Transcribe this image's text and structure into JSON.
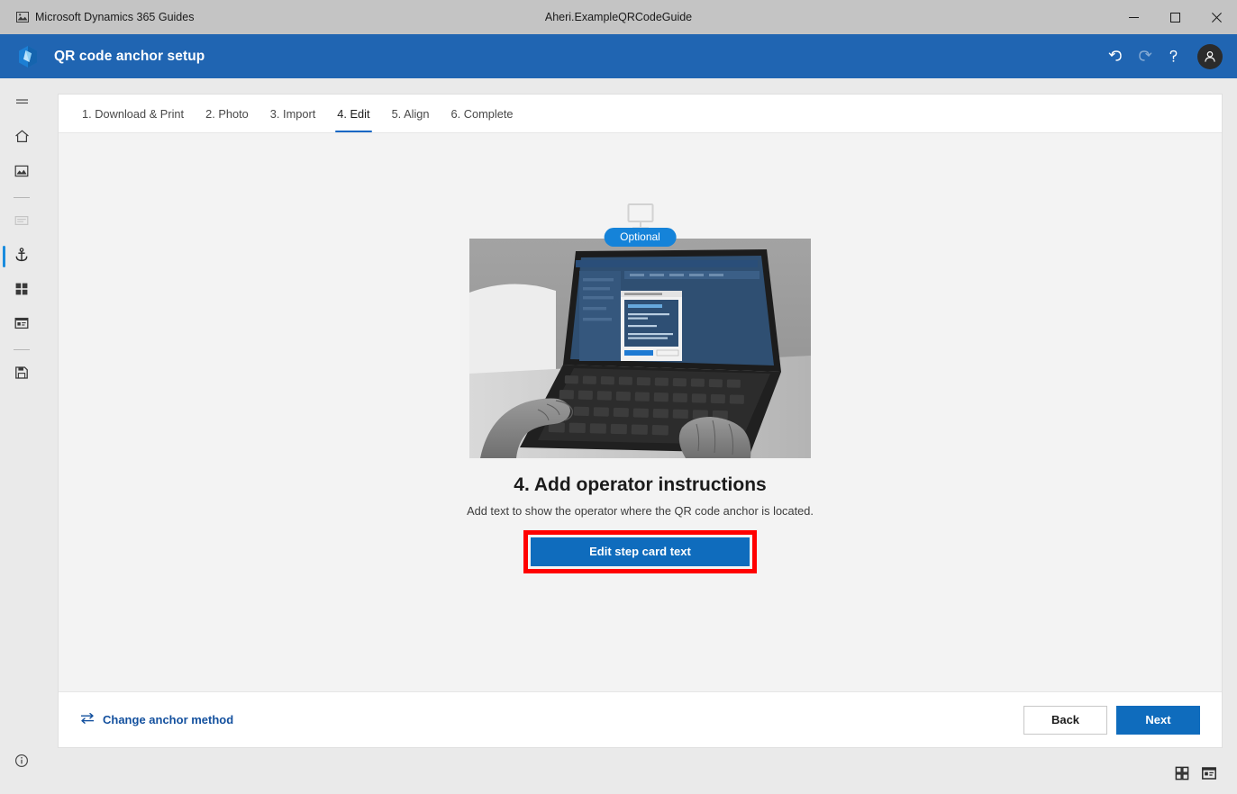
{
  "titlebar": {
    "app_icon": "app-photo-icon",
    "app_title": "Microsoft Dynamics 365 Guides",
    "document_title": "Aheri.ExampleQRCodeGuide",
    "minimize_label": "Minimize",
    "maximize_label": "Maximize",
    "close_label": "Close",
    "background": "#c4c4c4"
  },
  "header": {
    "logo": "dynamics-guides-logo",
    "title": "QR code anchor setup",
    "background": "#2065b2",
    "actions": [
      {
        "name": "undo-icon",
        "label": "Undo",
        "enabled": true
      },
      {
        "name": "redo-icon",
        "label": "Redo",
        "enabled": false
      },
      {
        "name": "help-icon",
        "label": "Help",
        "enabled": true
      }
    ],
    "avatar": {
      "name": "avatar",
      "label": "Account"
    }
  },
  "sidebar": {
    "items": [
      {
        "name": "menu-hamburger-icon",
        "label": "Menu",
        "state": "normal"
      },
      {
        "name": "home-icon",
        "label": "Home",
        "state": "normal"
      },
      {
        "name": "image-icon",
        "label": "Media",
        "state": "normal"
      },
      {
        "name": "step-card-icon",
        "label": "Step card",
        "state": "disabled"
      },
      {
        "name": "anchor-icon",
        "label": "Anchor",
        "state": "selected"
      },
      {
        "name": "grid-icon",
        "label": "Steps grid",
        "state": "normal"
      },
      {
        "name": "card-panel-icon",
        "label": "Card panel",
        "state": "normal"
      },
      {
        "name": "save-icon",
        "label": "Save",
        "state": "normal"
      }
    ],
    "info": {
      "name": "info-icon",
      "label": "Information"
    }
  },
  "tabs": [
    {
      "label": "1. Download & Print",
      "active": false
    },
    {
      "label": "2. Photo",
      "active": false
    },
    {
      "label": "3. Import",
      "active": false
    },
    {
      "label": "4. Edit",
      "active": true
    },
    {
      "label": "5. Align",
      "active": false
    },
    {
      "label": "6. Complete",
      "active": false
    }
  ],
  "main": {
    "device_icon": "monitor-icon",
    "badge": "Optional",
    "badge_color": "#1583d9",
    "photo_alt": "Hands typing on a laptop showing the Dynamics 365 Guides step card dialog",
    "title": "4. Add operator instructions",
    "description": "Add text to show the operator where the QR code anchor is located.",
    "cta_label": "Edit step card text",
    "cta_color": "#0f6cbd",
    "highlight_color": "#ff0000"
  },
  "footer": {
    "change_anchor_icon": "swap-arrows-icon",
    "change_anchor_label": "Change anchor method",
    "back_label": "Back",
    "next_label": "Next"
  },
  "statusbar": {
    "icons": [
      {
        "name": "grid-view-icon",
        "label": "Grid view"
      },
      {
        "name": "card-view-icon",
        "label": "Card view"
      }
    ]
  }
}
